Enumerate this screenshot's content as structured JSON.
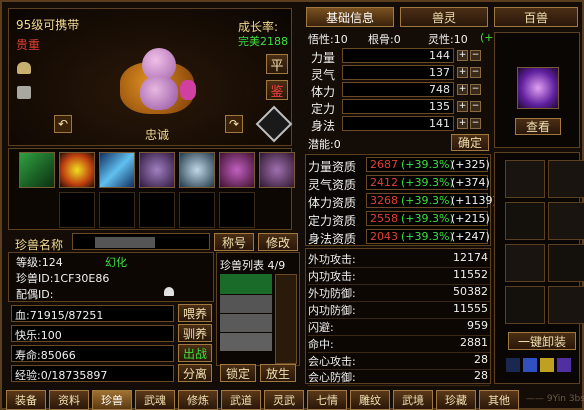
{
  "pet": {
    "level_name": "95级可携带",
    "rarity": "贵重",
    "growth_label": "成长率:",
    "growth_value": "完美2188",
    "ping": "平",
    "jian": "鉴",
    "loyalty": "忠诚"
  },
  "top_tabs": [
    "基础信息",
    "兽灵",
    "百兽"
  ],
  "attr_header": {
    "wuxing": "悟性:10",
    "gengu": "根骨:0",
    "lingxing": "灵性:10",
    "lingxing_pct": "(+34.0%)"
  },
  "base_stats": [
    {
      "label": "力量",
      "value": "144"
    },
    {
      "label": "灵气",
      "value": "137"
    },
    {
      "label": "体力",
      "value": "748"
    },
    {
      "label": "定力",
      "value": "135"
    },
    {
      "label": "身法",
      "value": "141"
    }
  ],
  "potential": {
    "label": "潜能:0",
    "confirm": "确定"
  },
  "zizhi": [
    {
      "label": "力量资质",
      "base": "2687",
      "pct": "(+39.3%)",
      "bonus": "(+325)"
    },
    {
      "label": "灵气资质",
      "base": "2412",
      "pct": "(+39.3%)",
      "bonus": "(+374)"
    },
    {
      "label": "体力资质",
      "base": "3268",
      "pct": "(+39.3%)",
      "bonus": "(+1139)"
    },
    {
      "label": "定力资质",
      "base": "2558",
      "pct": "(+39.3%)",
      "bonus": "(+215)"
    },
    {
      "label": "身法资质",
      "base": "2043",
      "pct": "(+39.3%)",
      "bonus": "(+247)"
    }
  ],
  "combat": [
    {
      "label": "外功攻击:",
      "value": "12174"
    },
    {
      "label": "内功攻击:",
      "value": "11552"
    },
    {
      "label": "外功防御:",
      "value": "50382"
    },
    {
      "label": "内功防御:",
      "value": "11555"
    },
    {
      "label": "闪避:",
      "value": "959"
    },
    {
      "label": "命中:",
      "value": "2881"
    },
    {
      "label": "会心攻击:",
      "value": "28"
    },
    {
      "label": "会心防御:",
      "value": "28"
    }
  ],
  "name_row": {
    "label": "珍兽名称",
    "rename": "称号",
    "modify": "修改"
  },
  "info": {
    "level": "等级:124",
    "huanhua": "幻化",
    "id": "珍兽ID:1CF30E86",
    "mate": "配偶ID:"
  },
  "list_title": "珍兽列表 4/9",
  "bars": [
    {
      "label": "血:71915/87251",
      "btn": "喂养",
      "btn_color": "#f0e0b0"
    },
    {
      "label": "快乐:100",
      "btn": "驯养",
      "btn_color": "#f0e0b0"
    },
    {
      "label": "寿命:85066",
      "btn": "出战",
      "btn_color": "#3ce03c"
    },
    {
      "label": "经验:0/18735897",
      "btn": "分离",
      "btn_color": "#f0e0b0"
    }
  ],
  "bottom_btns": {
    "lock": "锁定",
    "release": "放生",
    "view": "查看",
    "unequip": "一键卸装"
  },
  "bottom_tabs": [
    "装备",
    "资料",
    "珍兽",
    "武魂",
    "修炼",
    "武道",
    "灵武",
    "七情",
    "雕纹",
    "武境",
    "珍藏",
    "其他"
  ],
  "watermark": "—— 9Yin 3bs.com"
}
